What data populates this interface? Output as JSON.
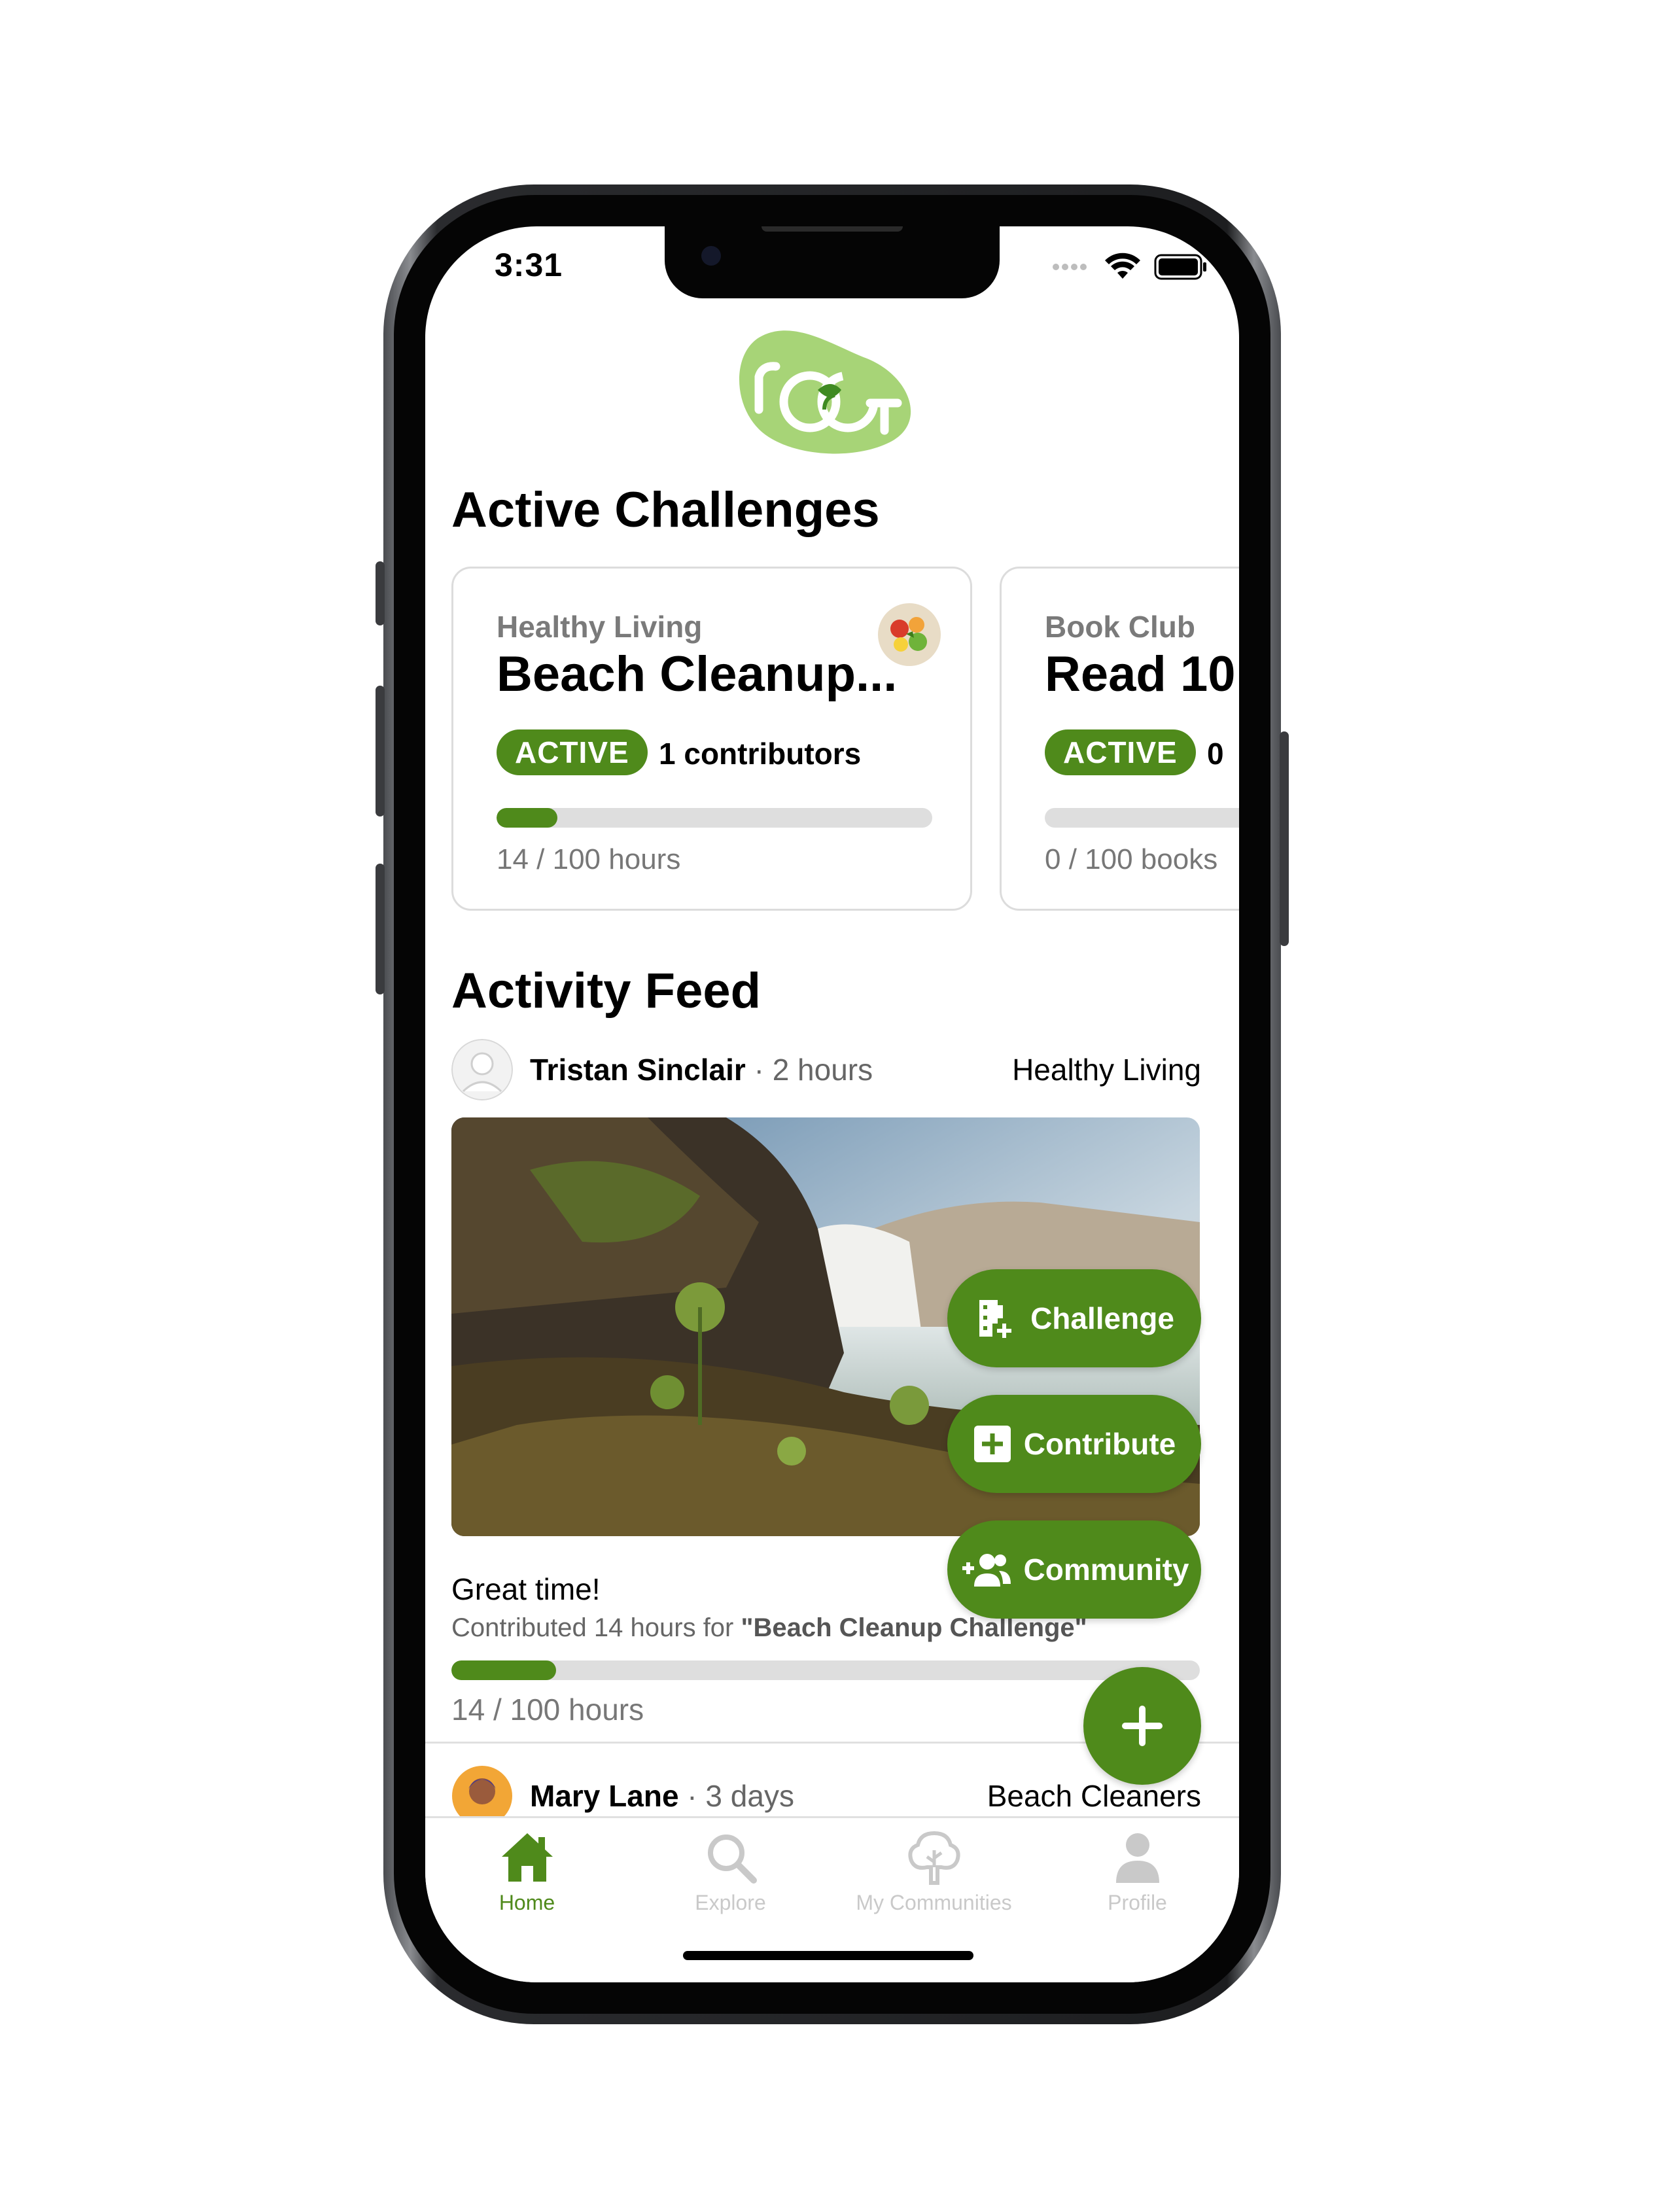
{
  "status_bar": {
    "time": "3:31"
  },
  "logo": {
    "name": "root-logo",
    "text": "ROOT"
  },
  "active_challenges": {
    "title": "Active Challenges",
    "cards": [
      {
        "category": "Healthy Living",
        "name": "Beach Cleanup...",
        "status": "ACTIVE",
        "contributors": "1 contributors",
        "progress_text": "14 / 100 hours",
        "progress": 0.14
      },
      {
        "category": "Book Club",
        "name": "Read 10",
        "status": "ACTIVE",
        "contributors": "0",
        "progress_text": "0 / 100 books",
        "progress": 0.0
      }
    ]
  },
  "activity_feed": {
    "title": "Activity Feed",
    "posts": [
      {
        "user": "Tristan Sinclair",
        "time": "2 hours",
        "community": "Healthy Living",
        "caption": "Great time!",
        "detail_prefix": "Contributed 14 hours for ",
        "detail_challenge": "\"Beach Cleanup Challenge\"",
        "progress_text": "14 / 100 hours",
        "progress": 0.14
      },
      {
        "user": "Mary Lane",
        "time": "3 days",
        "community": "Beach Cleaners"
      }
    ]
  },
  "fab_menu": {
    "challenge": "Challenge",
    "contribute": "Contribute",
    "community": "Community"
  },
  "tab_bar": {
    "items": [
      {
        "label": "Home",
        "icon": "home-icon",
        "active": true
      },
      {
        "label": "Explore",
        "icon": "search-icon",
        "active": false
      },
      {
        "label": "My Communities",
        "icon": "tree-icon",
        "active": false
      },
      {
        "label": "Profile",
        "icon": "person-icon",
        "active": false
      }
    ]
  },
  "colors": {
    "accent": "#4f8a1b",
    "logo_bg": "#a7d477",
    "track": "#dedede",
    "inactive": "#c9c9c9"
  }
}
